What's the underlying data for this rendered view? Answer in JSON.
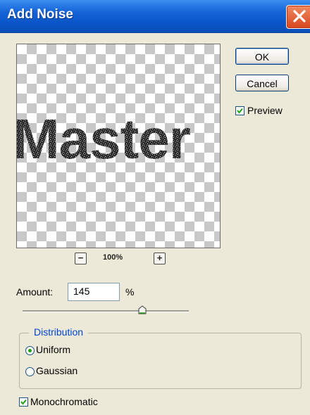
{
  "window": {
    "title": "Add Noise"
  },
  "buttons": {
    "ok": "OK",
    "cancel": "Cancel"
  },
  "preview": {
    "enabled": true,
    "label": "Preview",
    "zoom": "100%",
    "sample_text": "Master"
  },
  "amount": {
    "label": "Amount:",
    "value": "145",
    "unit": "%",
    "slider_fraction": 0.72
  },
  "distribution": {
    "legend": "Distribution",
    "options": [
      {
        "label": "Uniform",
        "selected": true
      },
      {
        "label": "Gaussian",
        "selected": false
      }
    ]
  },
  "monochromatic": {
    "label": "Monochromatic",
    "checked": true
  },
  "colors": {
    "titlebar": "#0a55c8",
    "close": "#d8461f",
    "legend": "#0046d5",
    "check": "#22a114"
  }
}
